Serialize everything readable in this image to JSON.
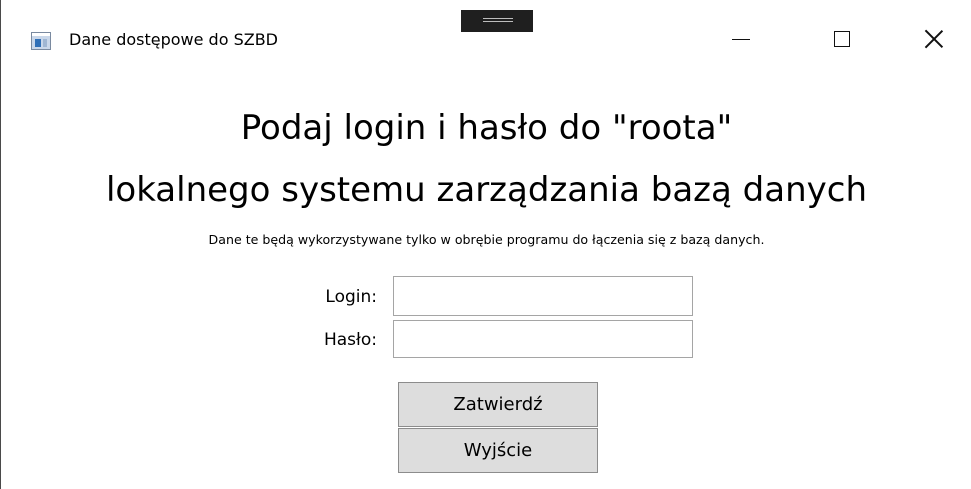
{
  "window": {
    "title": "Dane dostępowe do SZBD",
    "icon": "window-app-icon",
    "controls": {
      "minimize": "minimize-icon",
      "maximize": "maximize-icon",
      "close": "close-icon"
    }
  },
  "content": {
    "heading_line1": "Podaj login i hasło do \"roota\"",
    "heading_line2": "lokalnego systemu zarządzania bazą danych",
    "subtitle": "Dane te będą wykorzystywane tylko w obrębie programu do łączenia się z bazą danych."
  },
  "form": {
    "login_label": "Login:",
    "login_value": "",
    "password_label": "Hasło:",
    "password_value": ""
  },
  "buttons": {
    "submit_label": "Zatwierdź",
    "exit_label": "Wyjście"
  },
  "colors": {
    "button_background": "#dddddd",
    "button_border": "#8c8c8c",
    "field_border": "#a5a5a5"
  }
}
